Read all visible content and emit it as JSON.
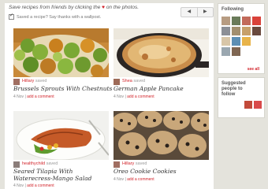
{
  "header": {
    "intro_before": "Save recipes from friends by clicking the",
    "heart_glyph": "♥",
    "intro_after": "on the photos.",
    "saved_notice": "Saved a recipe? Say thanks with a wallpost.",
    "pager_prev": "◀",
    "pager_next": "▶"
  },
  "cards": [
    {
      "user": "Hillary",
      "action": "saved",
      "title": "Brussels Sprouts With Chestnuts",
      "date": "4 Nov",
      "add": "add a comment"
    },
    {
      "user": "Shea",
      "action": "saved",
      "title": "German Apple Pancake",
      "date": "4 Nov",
      "add": "add a comment"
    },
    {
      "user": "healthychild",
      "action": "saved",
      "title_line1": "Seared Tilapia With",
      "title_line2": "Waterecress-Mango Salad",
      "date": "4 Nov",
      "add": "add a comment"
    },
    {
      "user": "Hillary",
      "action": "saved",
      "title": "Oreo Cookie Cookies",
      "date": "4 Nov",
      "add": "add a comment"
    }
  ],
  "sidebar": {
    "following_title": "Following",
    "see_all": "see all",
    "suggested_line1": "Suggested",
    "suggested_line2": "people to",
    "suggested_line3": "follow"
  },
  "colors": {
    "accent": "#d2232a",
    "background": "#e4e3dc"
  }
}
